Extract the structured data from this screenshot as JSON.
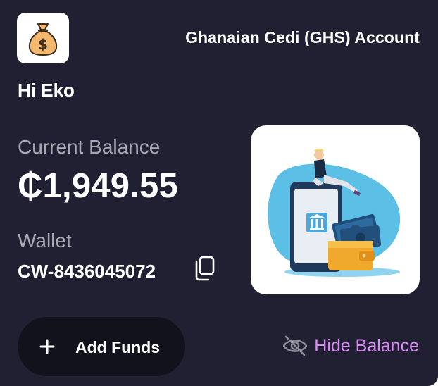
{
  "account": {
    "title": "Ghanaian Cedi (GHS) Account"
  },
  "user": {
    "greeting": "Hi Eko"
  },
  "balance": {
    "label": "Current Balance",
    "amount": "₵1,949.55"
  },
  "wallet": {
    "label": "Wallet",
    "id": "CW-8436045072"
  },
  "actions": {
    "add_funds_label": "Add Funds",
    "hide_balance_label": "Hide Balance"
  },
  "icons": {
    "logo": "money-bag-icon",
    "copy": "copy-icon",
    "add": "plus-icon",
    "hide": "eye-off-icon"
  },
  "colors": {
    "card_background": "#202032",
    "button_background": "#12121d",
    "hide_balance_accent": "#d98cf3",
    "money_bag": "#f4b96f"
  }
}
